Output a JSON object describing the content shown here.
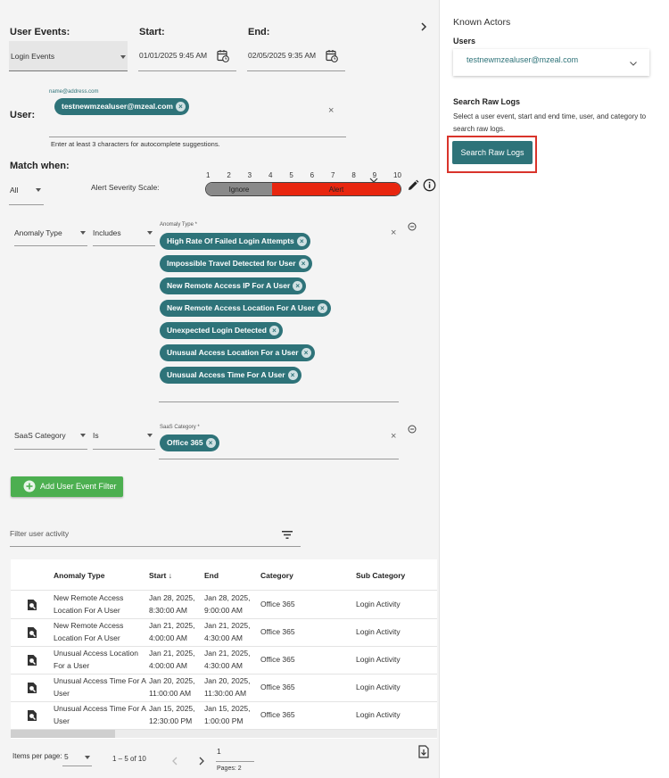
{
  "filters": {
    "user_events_label": "User Events:",
    "user_events_value": "Login Events",
    "start_label": "Start:",
    "start_value": "01/01/2025 9:45 AM",
    "end_label": "End:",
    "end_value": "02/05/2025 9:35 AM",
    "user_label": "User:",
    "user_placeholder": "name@address.com",
    "user_chip": "testnewmzealuser@mzeal.com",
    "user_hint": "Enter at least 3 characters for autocomplete suggestions.",
    "match_when_label": "Match when:",
    "match_value": "All",
    "severity_label": "Alert Severity Scale:",
    "severity_ticks": [
      "1",
      "2",
      "3",
      "4",
      "5",
      "6",
      "7",
      "8",
      "9",
      "10"
    ],
    "severity_ignore": "Ignore",
    "severity_alert": "Alert",
    "severity_threshold": 4
  },
  "condition1": {
    "field": "Anomaly Type",
    "operator": "Includes",
    "values_label": "Anomaly Type *",
    "chips": [
      "High Rate Of Failed Login Attempts",
      "Impossible Travel Detected for User",
      "New Remote Access IP For A User",
      "New Remote Access Location For A User",
      "Unexpected Login Detected",
      "Unusual Access Location For a User",
      "Unusual Access Time For A User"
    ]
  },
  "condition2": {
    "field": "SaaS Category",
    "operator": "Is",
    "values_label": "SaaS Category *",
    "chips": [
      "Office 365"
    ]
  },
  "add_filter_label": "Add User Event Filter",
  "activity_filter_placeholder": "Filter user activity",
  "table": {
    "headers": [
      "Anomaly Type",
      "Start",
      "End",
      "Category",
      "Sub Category"
    ],
    "sort_indicator": "↓",
    "rows": [
      {
        "type_l1": "New Remote Access",
        "type_l2": "Location For A User",
        "start_l1": "Jan 28, 2025,",
        "start_l2": "8:30:00 AM",
        "end_l1": "Jan 28, 2025,",
        "end_l2": "9:00:00 AM",
        "category": "Office 365",
        "sub": "Login Activity"
      },
      {
        "type_l1": "New Remote Access",
        "type_l2": "Location For A User",
        "start_l1": "Jan 21, 2025,",
        "start_l2": "4:00:00 AM",
        "end_l1": "Jan 21, 2025,",
        "end_l2": "4:30:00 AM",
        "category": "Office 365",
        "sub": "Login Activity"
      },
      {
        "type_l1": "Unusual Access Location",
        "type_l2": "For a User",
        "start_l1": "Jan 21, 2025,",
        "start_l2": "4:00:00 AM",
        "end_l1": "Jan 21, 2025,",
        "end_l2": "4:30:00 AM",
        "category": "Office 365",
        "sub": "Login Activity"
      },
      {
        "type_l1": "Unusual Access Time For A",
        "type_l2": "User",
        "start_l1": "Jan 20, 2025,",
        "start_l2": "11:00:00 AM",
        "end_l1": "Jan 20, 2025,",
        "end_l2": "11:30:00 AM",
        "category": "Office 365",
        "sub": "Login Activity"
      },
      {
        "type_l1": "Unusual Access Time For A",
        "type_l2": "User",
        "start_l1": "Jan 15, 2025,",
        "start_l2": "12:30:00 PM",
        "end_l1": "Jan 15, 2025,",
        "end_l2": "1:00:00 PM",
        "category": "Office 365",
        "sub": "Login Activity"
      }
    ]
  },
  "pagination": {
    "items_per_page_label": "Items per page:",
    "items_per_page": "5",
    "range": "1 – 5 of 10",
    "page": "1",
    "pages_label": "Pages: 2"
  },
  "sidebar": {
    "title": "Known Actors",
    "users_label": "Users",
    "user_value": "testnewmzealuser@mzeal.com",
    "search_title": "Search Raw Logs",
    "search_desc": "Select a user event, start and end time, user, and category to search raw logs.",
    "search_button": "Search Raw Logs"
  },
  "colors": {
    "chip": "#2e7379",
    "alert": "#e8260f",
    "ignore": "#8a8a8a",
    "add_button": "#4caf50",
    "search_button": "#2e7379",
    "highlight": "#d9342b"
  }
}
